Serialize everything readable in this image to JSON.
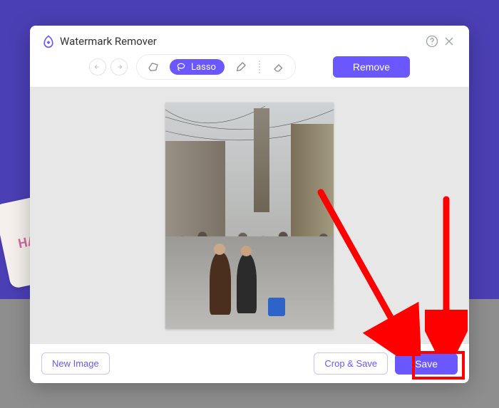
{
  "app": {
    "title": "Watermark Remover"
  },
  "toolbar": {
    "lasso_label": "Lasso",
    "remove_label": "Remove"
  },
  "footer": {
    "new_image_label": "New Image",
    "crop_save_label": "Crop & Save",
    "save_label": "Save"
  },
  "colors": {
    "accent": "#6b57ff",
    "annotation": "#ff0000"
  },
  "bg_card_text": "HA"
}
